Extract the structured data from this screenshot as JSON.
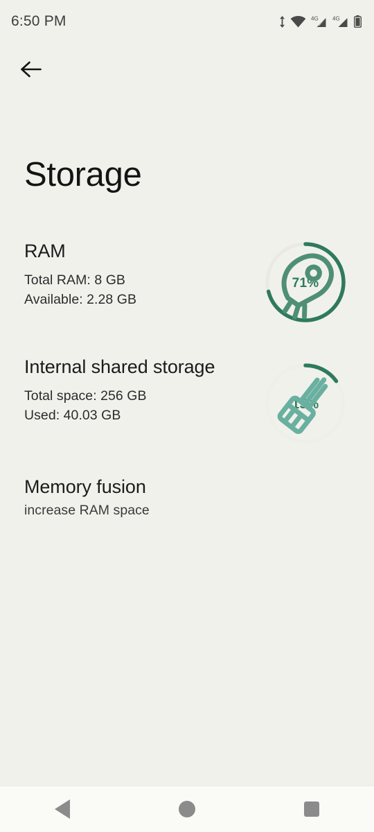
{
  "status_bar": {
    "time": "6:50 PM",
    "icons": [
      "data-transfer-icon",
      "wifi-icon",
      "signal-4g-icon-1",
      "signal-4g-icon-2",
      "battery-icon"
    ],
    "network_label": "4G"
  },
  "nav": {
    "back_label": "back-arrow"
  },
  "header": {
    "title": "Storage"
  },
  "sections": {
    "ram": {
      "heading": "RAM",
      "line1": "Total RAM: 8 GB",
      "line2": "Available: 2.28 GB",
      "ring": {
        "percent_label": "71%",
        "percent_value": 71,
        "icon": "rocket-icon",
        "arc_color": "#2f7a5d",
        "track_color": "#eaeae4"
      }
    },
    "internal_storage": {
      "heading": "Internal shared storage",
      "line1": "Total space: 256 GB",
      "line2": "Used: 40.03 GB",
      "ring": {
        "percent_label": "15%",
        "percent_value": 15,
        "icon": "brush-icon",
        "arc_color": "#2f7a5d",
        "track_color": "#efefe9"
      }
    },
    "memory_fusion": {
      "heading": "Memory fusion",
      "subtitle": "increase RAM space"
    }
  },
  "system_nav": {
    "back": "back-triangle",
    "home": "home-circle",
    "recents": "recents-square"
  },
  "colors": {
    "background": "#f1f1ec",
    "accent_green": "#2f7a5d",
    "accent_teal": "#69b0a0",
    "text_primary": "#141414",
    "nav_bar_bg": "#fafaf7"
  }
}
